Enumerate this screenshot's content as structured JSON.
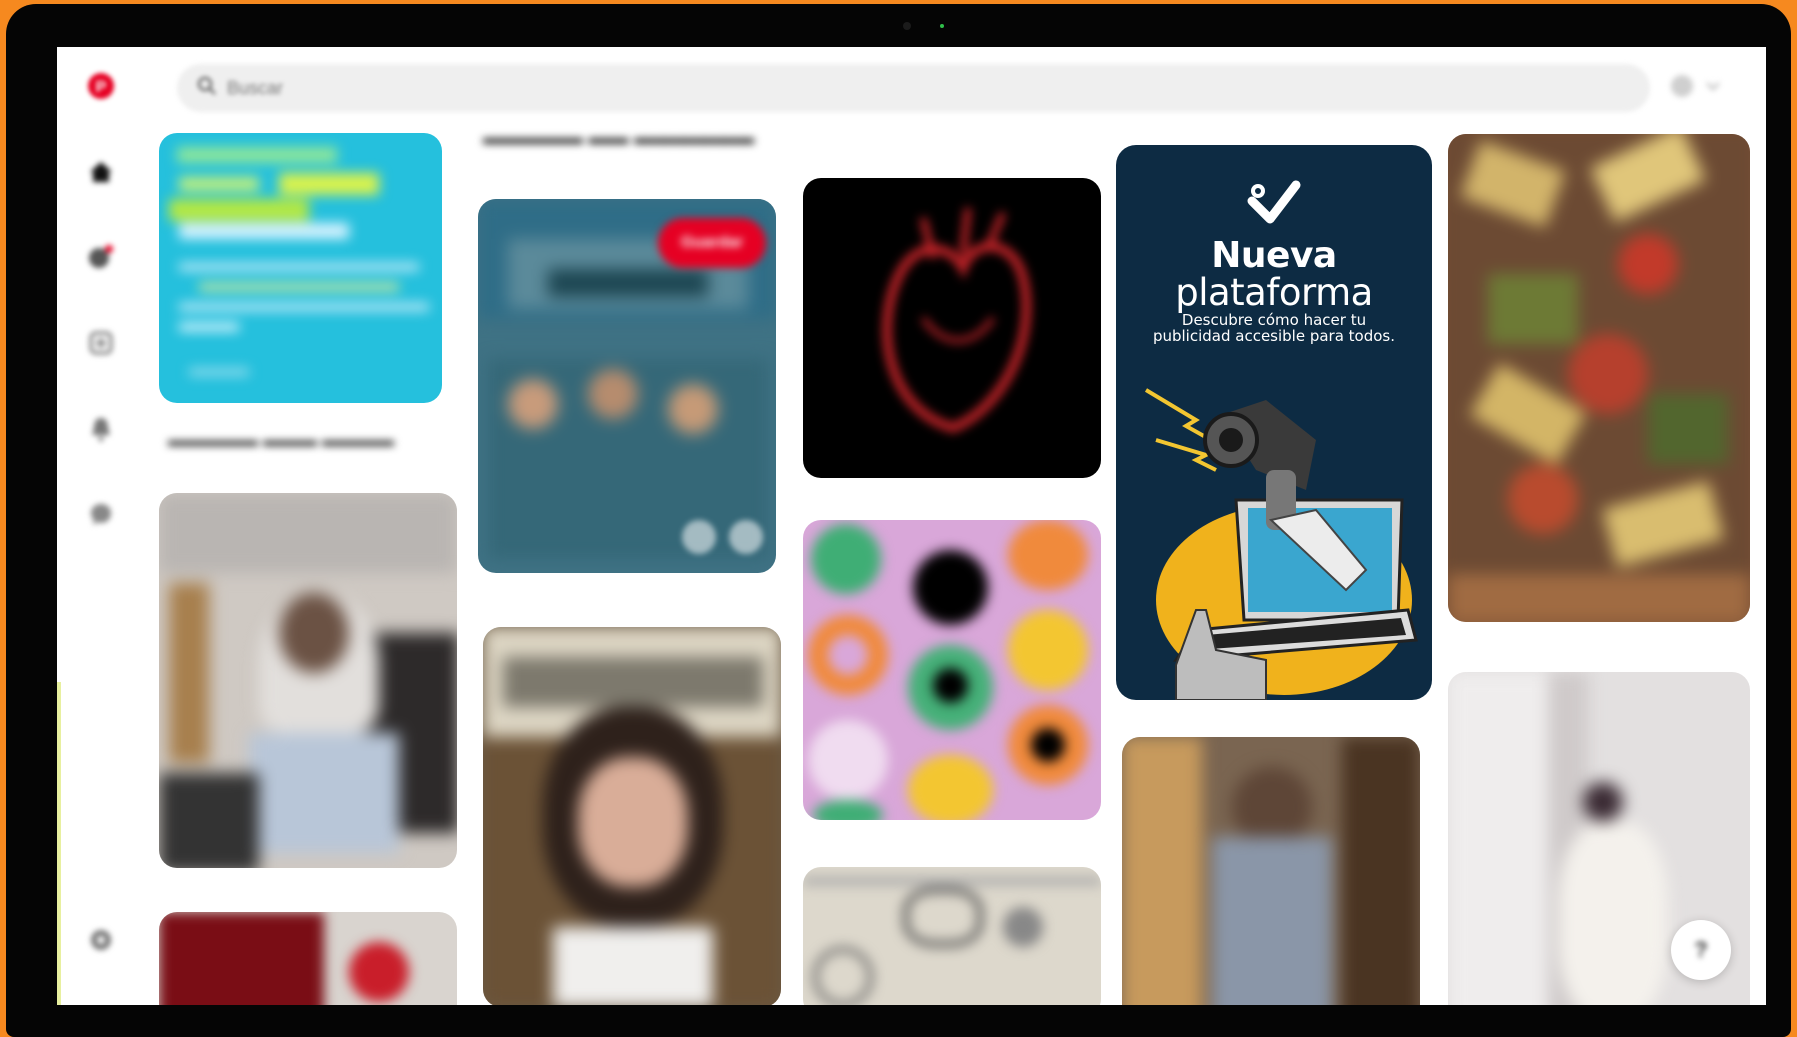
{
  "header": {
    "search_placeholder": "Buscar",
    "icons": [
      "search-icon",
      "notifications-icon",
      "chevron-down-icon"
    ]
  },
  "sidebar": {
    "items": [
      {
        "name": "logo-icon"
      },
      {
        "name": "home-icon"
      },
      {
        "name": "explore-icon"
      },
      {
        "name": "create-icon"
      },
      {
        "name": "notifications-icon"
      },
      {
        "name": "messages-icon"
      },
      {
        "name": "settings-icon"
      }
    ]
  },
  "feed": {
    "save_label": "Guardar",
    "ad": {
      "title_bold": "Nueva",
      "title_light": "plataforma",
      "subtitle_line1": "Descubre cómo hacer tu",
      "subtitle_line2": "publicidad accesible para todos."
    }
  },
  "help": {
    "label": "?"
  },
  "colors": {
    "accent": "#e60023",
    "ad_background": "#0d2b43",
    "frame": "#f6891f"
  }
}
